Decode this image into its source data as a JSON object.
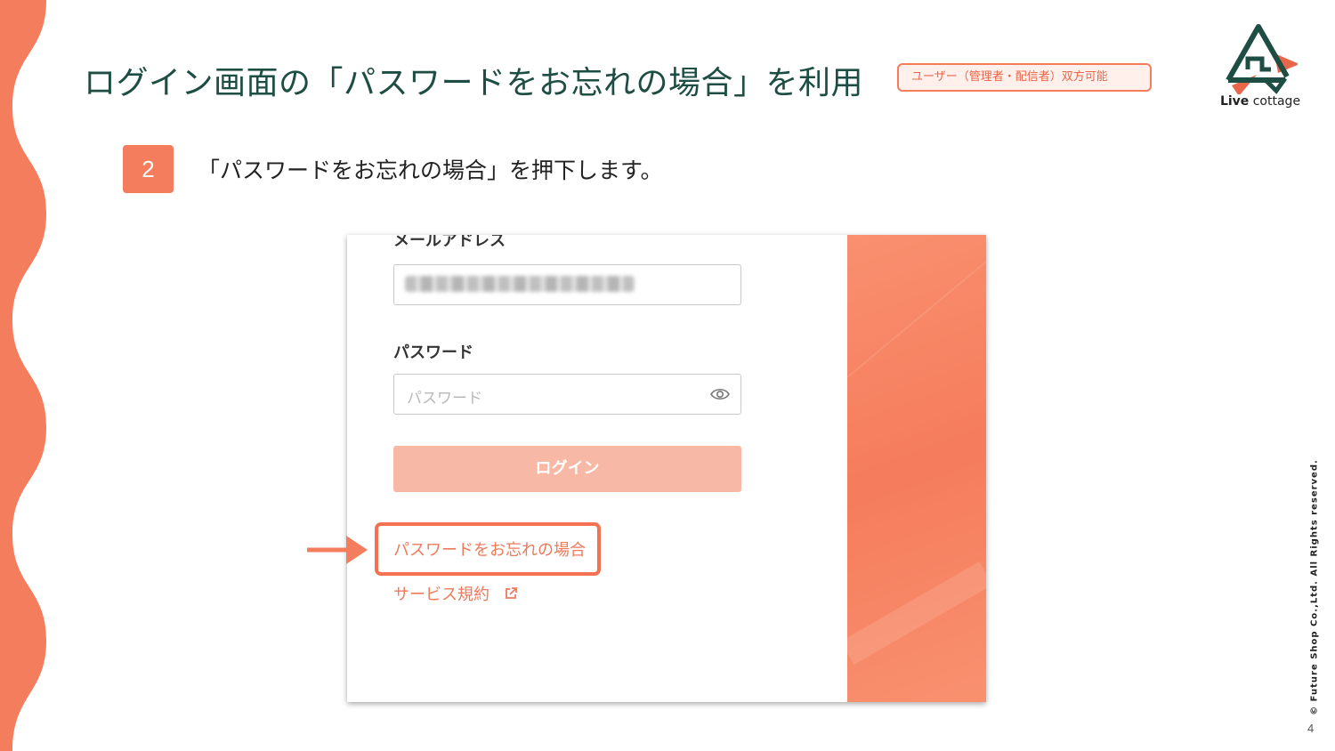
{
  "slide": {
    "title": "ログイン画面の「パスワードをお忘れの場合」を利用",
    "audience_badge": "ユーザー（管理者・配信者）双方可能",
    "step_number": "2",
    "step_text": "「パスワードをお忘れの場合」を押下します。",
    "copyright": "© Future Shop Co.,Ltd. All Rights reserved.",
    "page_number": "4"
  },
  "logo": {
    "text_bold": "Live",
    "text_regular": " cottage",
    "icon": "house-mountain-logo-icon"
  },
  "login_form": {
    "email_label": "メールアドレス",
    "email_value_blurred": true,
    "password_label": "パスワード",
    "password_placeholder": "パスワード",
    "password_toggle_icon": "eye-icon",
    "login_button": "ログイン",
    "forgot_password_link": "パスワードをお忘れの場合",
    "terms_link": "サービス規約",
    "terms_icon": "external-link-icon"
  },
  "colors": {
    "accent": "#f47d5d",
    "title": "#1d4d43",
    "link": "#ee7a5c",
    "button_disabled": "#f8b8a6"
  }
}
